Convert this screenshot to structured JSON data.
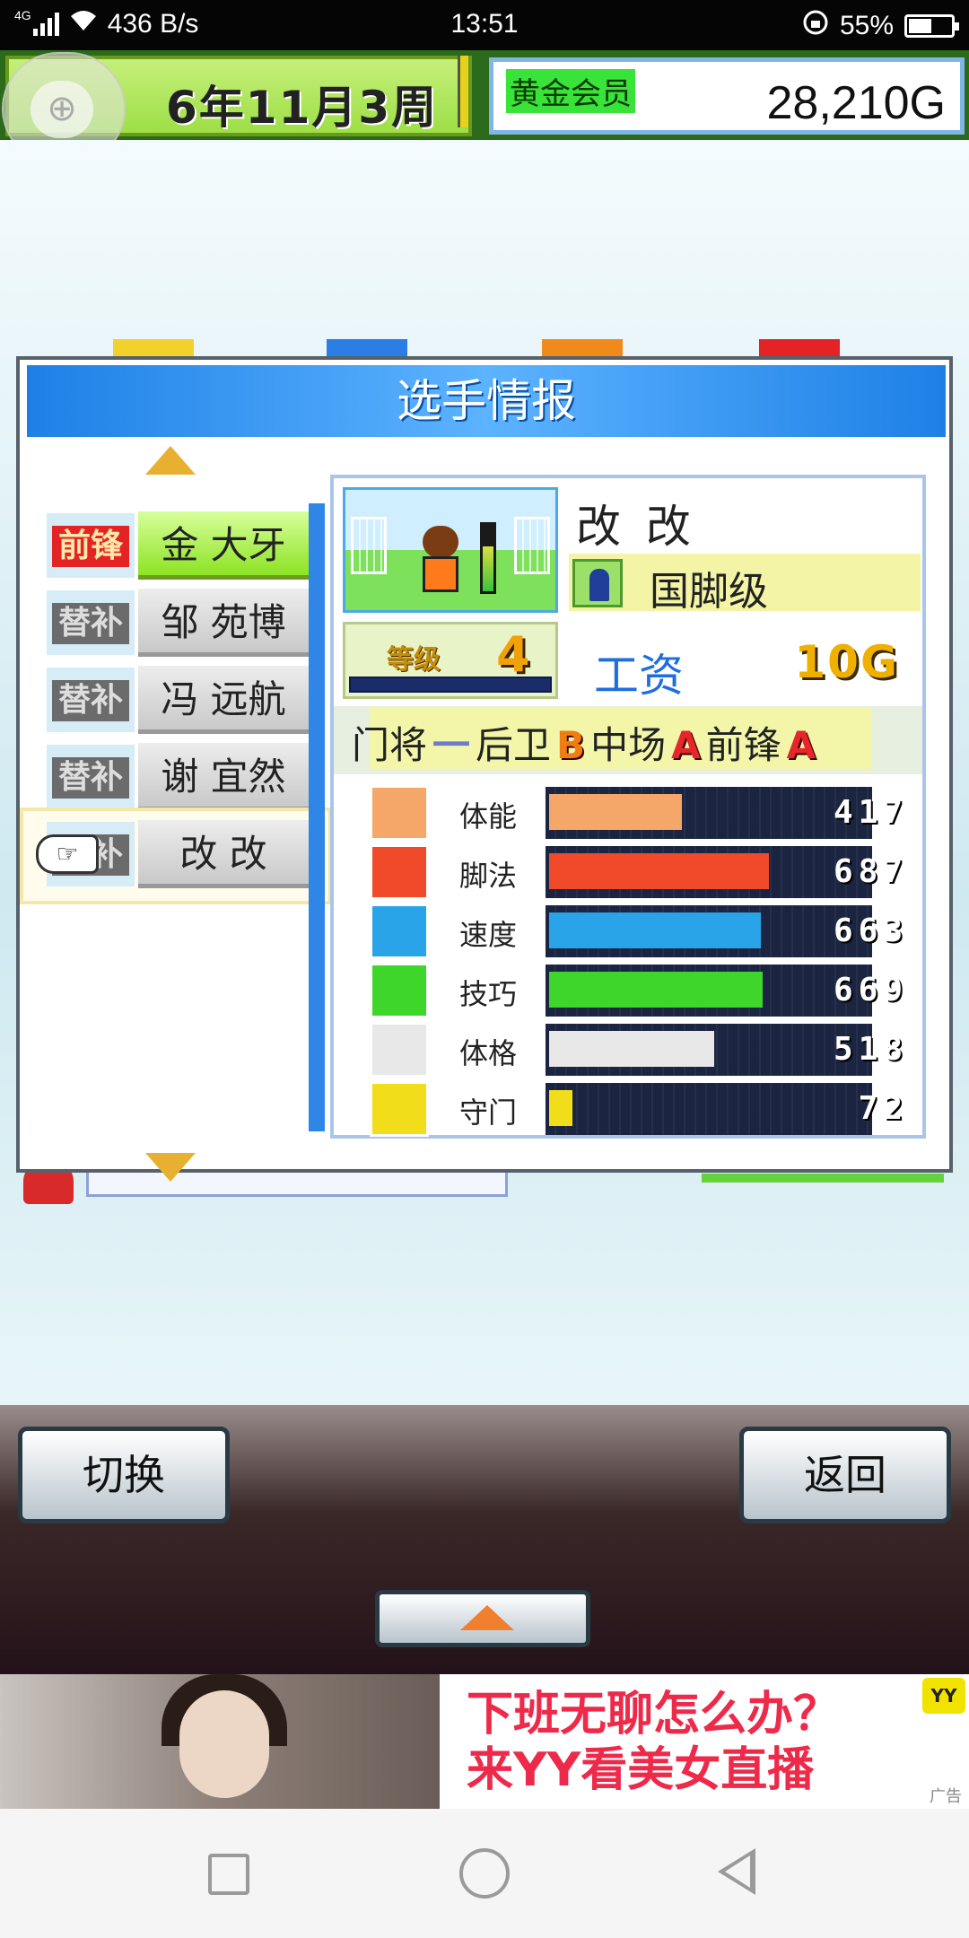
{
  "status_bar": {
    "network_type": "4G",
    "net_speed": "436 B/s",
    "time": "13:51",
    "battery": "55%",
    "battery_level": 0.55
  },
  "top_bar": {
    "date": "6年11月3周",
    "membership": "黄金会员",
    "money": "28,210G"
  },
  "dialog": {
    "title": "选手情报",
    "roster": [
      {
        "position": "前锋",
        "name": "金 大牙",
        "active": true
      },
      {
        "position": "替补",
        "name": "邹 苑博",
        "active": false
      },
      {
        "position": "替补",
        "name": "冯 远航",
        "active": false
      },
      {
        "position": "替补",
        "name": "谢 宜然",
        "active": false
      },
      {
        "position": "替补",
        "name": "改 改",
        "active": false,
        "selected": true
      }
    ],
    "player": {
      "name": "改 改",
      "rank": "国脚级",
      "level_label": "等级",
      "level": "4",
      "wage_label": "工资",
      "wage": "10G",
      "positions": [
        {
          "label": "门将",
          "grade": "一"
        },
        {
          "label": "后卫",
          "grade": "B"
        },
        {
          "label": "中场",
          "grade": "A"
        },
        {
          "label": "前锋",
          "grade": "A"
        }
      ],
      "stats": [
        {
          "label": "体能",
          "value": "417",
          "color": "#f5a76a",
          "icon": "stamina-icon"
        },
        {
          "label": "脚法",
          "value": "687",
          "color": "#f04a2a",
          "icon": "kick-icon"
        },
        {
          "label": "速度",
          "value": "663",
          "color": "#2aa4e8",
          "icon": "speed-icon"
        },
        {
          "label": "技巧",
          "value": "669",
          "color": "#3fd62c",
          "icon": "technique-icon"
        },
        {
          "label": "体格",
          "value": "518",
          "color": "#e8e8e8",
          "icon": "physique-icon"
        },
        {
          "label": "守门",
          "value": "72",
          "color": "#f2dd1a",
          "icon": "goalkeeping-icon"
        }
      ],
      "stat_max": 1000
    }
  },
  "controls": {
    "switch_label": "切换",
    "back_label": "返回"
  },
  "ad": {
    "line1": "下班无聊怎么办？",
    "line2": "来YY看美女直播",
    "badge": "YY",
    "tag": "广告"
  }
}
